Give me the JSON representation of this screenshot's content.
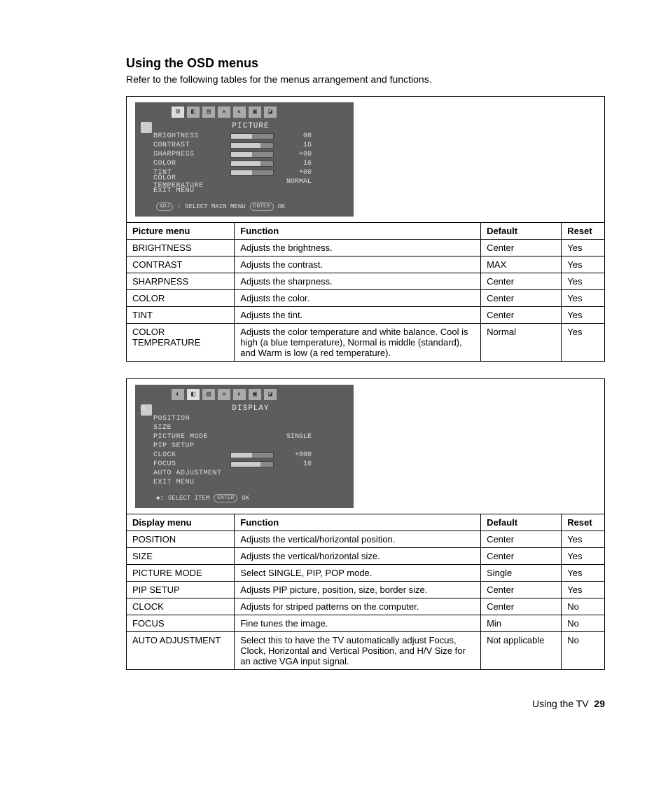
{
  "heading": "Using the OSD menus",
  "intro": "Refer to the following tables for the menus arrangement and functions.",
  "osd1": {
    "title": "PICTURE",
    "rows": [
      {
        "label": "BRIGHTNESS",
        "bar": 50,
        "val": "08"
      },
      {
        "label": "CONTRAST",
        "bar": 70,
        "val": "16"
      },
      {
        "label": "SHARPNESS",
        "bar": 50,
        "val": "+00"
      },
      {
        "label": "COLOR",
        "bar": 70,
        "val": "16"
      },
      {
        "label": "TINT",
        "bar": 50,
        "val": "+00"
      },
      {
        "label": "COLOR TEMPERATURE",
        "bar": null,
        "val": "NORMAL"
      },
      {
        "label": "EXIT MENU",
        "bar": null,
        "val": ""
      }
    ],
    "footer_pill": "ADJ",
    "footer_label": ": SELECT MAIN MENU",
    "footer_pill2": "ENTER",
    "footer_ok": "OK"
  },
  "osd2": {
    "title": "DISPLAY",
    "rows": [
      {
        "label": "POSITION",
        "bar": null,
        "val": ""
      },
      {
        "label": "SIZE",
        "bar": null,
        "val": ""
      },
      {
        "label": "PICTURE MODE",
        "bar": null,
        "val": "SINGLE"
      },
      {
        "label": "PIP SETUP",
        "bar": null,
        "val": ""
      },
      {
        "label": "CLOCK",
        "bar": 50,
        "val": "+000"
      },
      {
        "label": "FOCUS",
        "bar": 70,
        "val": "16"
      },
      {
        "label": "AUTO ADJUSTMENT",
        "bar": null,
        "val": ""
      },
      {
        "label": "EXIT MENU",
        "bar": null,
        "val": ""
      }
    ],
    "footer_icon": "◆:",
    "footer_label": "SELECT ITEM",
    "footer_pill2": "ENTER",
    "footer_ok": "OK"
  },
  "table1": {
    "headers": [
      "Picture menu",
      "Function",
      "Default",
      "Reset"
    ],
    "rows": [
      [
        "BRIGHTNESS",
        "Adjusts the brightness.",
        "Center",
        "Yes"
      ],
      [
        "CONTRAST",
        "Adjusts the contrast.",
        "MAX",
        "Yes"
      ],
      [
        "SHARPNESS",
        "Adjusts the sharpness.",
        "Center",
        "Yes"
      ],
      [
        "COLOR",
        "Adjusts the color.",
        "Center",
        "Yes"
      ],
      [
        "TINT",
        "Adjusts the tint.",
        "Center",
        "Yes"
      ],
      [
        "COLOR TEMPERATURE",
        "Adjusts the color temperature and white balance. Cool is high (a blue temperature), Normal is middle (standard), and Warm is low (a red temperature).",
        "Normal",
        "Yes"
      ]
    ]
  },
  "table2": {
    "headers": [
      "Display menu",
      "Function",
      "Default",
      "Reset"
    ],
    "rows": [
      [
        "POSITION",
        "Adjusts the vertical/horizontal position.",
        "Center",
        "Yes"
      ],
      [
        "SIZE",
        "Adjusts the vertical/horizontal size.",
        "Center",
        "Yes"
      ],
      [
        "PICTURE MODE",
        "Select SINGLE, PIP, POP mode.",
        "Single",
        "Yes"
      ],
      [
        "PIP SETUP",
        "Adjusts PIP picture, position, size, border size.",
        "Center",
        "Yes"
      ],
      [
        "CLOCK",
        "Adjusts for striped patterns on the computer.",
        "Center",
        "No"
      ],
      [
        "FOCUS",
        "Fine tunes the image.",
        "Min",
        "No"
      ],
      [
        "AUTO ADJUSTMENT",
        "Select this to have the TV automatically adjust Focus, Clock, Horizontal and Vertical Position, and H/V Size for an active VGA input signal.",
        "Not applicable",
        "No"
      ]
    ]
  },
  "footer": {
    "text": "Using the TV",
    "page": "29"
  }
}
